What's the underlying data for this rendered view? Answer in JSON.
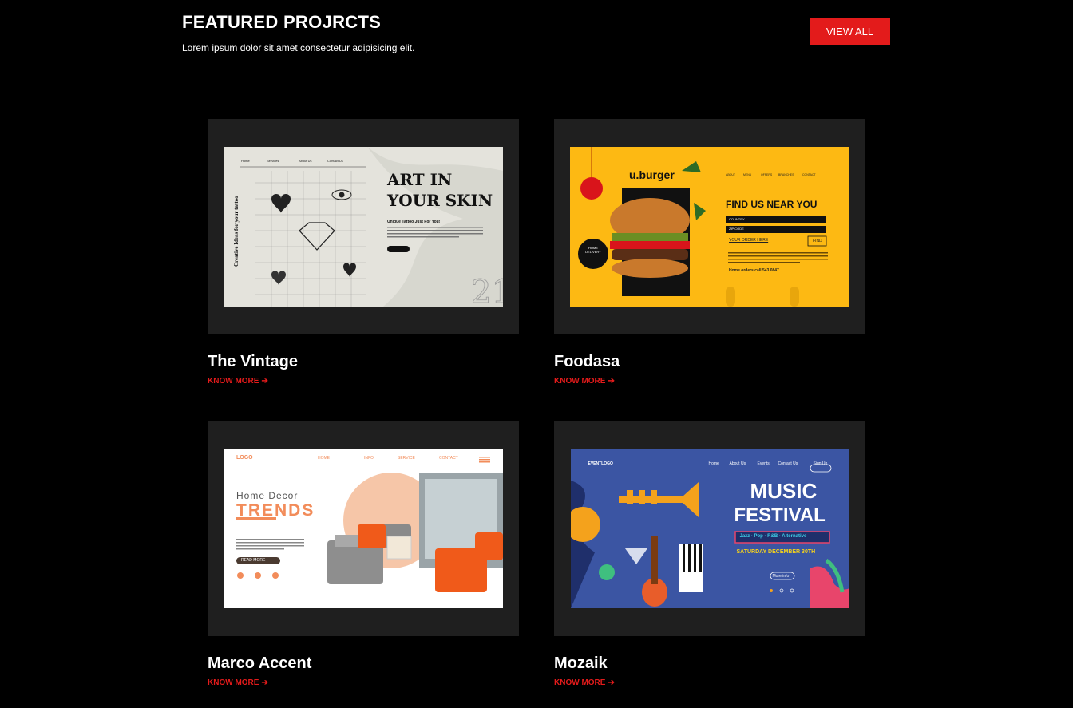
{
  "header": {
    "title": "FEATURED PROJRCTS",
    "subtitle": "Lorem ipsum dolor sit amet consectetur adipisicing elit.",
    "view_all_label": "VIEW ALL"
  },
  "cards": [
    {
      "title": "The Vintage",
      "link_label": "KNOW MORE",
      "link_icon": "arrow-right-icon"
    },
    {
      "title": "Foodasa",
      "link_label": "KNOW MORE",
      "link_icon": "arrow-right-icon"
    },
    {
      "title": "Marco Accent",
      "link_label": "KNOW MORE",
      "link_icon": "arrow-right-icon"
    },
    {
      "title": "Mozaik",
      "link_label": "KNOW MORE",
      "link_icon": "arrow-right-icon"
    }
  ],
  "previews": {
    "vintage": {
      "nav": [
        "Home",
        "Services",
        "About Us",
        "Contact Us"
      ],
      "headline": "ART IN YOUR SKIN",
      "tagline": "Unique Tattoo Just For You!",
      "side_text": "Creative Ideas for your tattoo"
    },
    "burger": {
      "brand": "u.burger",
      "nav": [
        "ABOUT",
        "MENU",
        "OFFERS",
        "BRANCHES",
        "CONTACT"
      ],
      "headline": "FIND US NEAR YOU",
      "fields": [
        "COUNTRY",
        "ZIP CODE"
      ],
      "order_link": "YOUR ORDER HERE",
      "find_button": "FIND",
      "badge": "HOME DELIVERY",
      "phone": "Home orders call 543 0847"
    },
    "decor": {
      "logo": "LOGO",
      "nav": [
        "HOME",
        "INFO",
        "SERVICE",
        "CONTACT"
      ],
      "headline_small": "Home Decor",
      "headline_big": "TRENDS",
      "button": "READ MORE"
    },
    "music": {
      "logo": "EVENTLOGO",
      "nav": [
        "Home",
        "About Us",
        "Events",
        "Contact Us"
      ],
      "signup": "Sign Up",
      "headline1": "MUSIC",
      "headline2": "FESTIVAL",
      "genres": "Jazz · Pop · R&B · Alternative",
      "date": "SATURDAY DECEMBER 30TH",
      "more_info": "More info"
    }
  },
  "colors": {
    "background": "#000000",
    "accent": "#e31b1b",
    "card_bg": "#1f1f1f"
  }
}
